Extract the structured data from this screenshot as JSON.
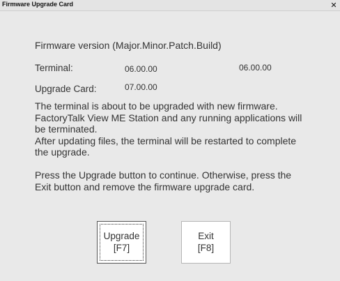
{
  "window": {
    "title": "Firmware Upgrade Card",
    "close_glyph": "✕"
  },
  "version_info": {
    "heading": "Firmware version (Major.Minor.Patch.Build)",
    "terminal_label": "Terminal:",
    "terminal_value_1": "06.00.00",
    "terminal_value_2": "06.00.00",
    "card_label": "Upgrade Card:",
    "card_value": "07.00.00"
  },
  "message": {
    "line1": "The terminal is about to be upgraded with new firmware.",
    "line2": "FactoryTalk View ME Station and any running applications will",
    "line3": "be terminated.",
    "line4": "After updating files, the terminal will be restarted to complete",
    "line5": "the upgrade.",
    "line6": "Press the Upgrade button to continue. Otherwise, press the",
    "line7": "Exit button and remove the firmware upgrade card."
  },
  "buttons": {
    "upgrade_label": "Upgrade",
    "upgrade_key": "[F7]",
    "exit_label": "Exit",
    "exit_key": "[F8]"
  }
}
